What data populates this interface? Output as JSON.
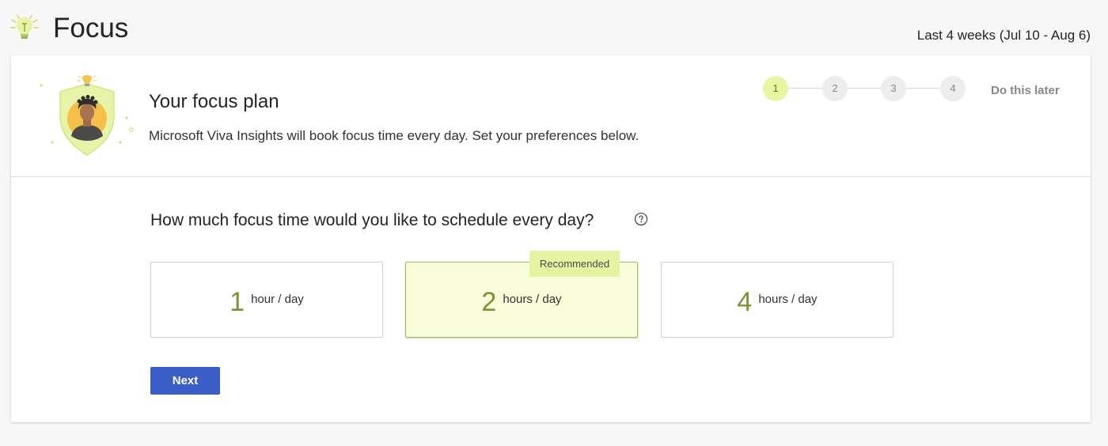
{
  "app": {
    "title": "Focus",
    "icon": "lightbulb-icon",
    "date_range": "Last 4 weeks (Jul 10 - Aug 6)"
  },
  "plan": {
    "title": "Your focus plan",
    "description": "Microsoft Viva Insights will book focus time every day. Set your preferences below.",
    "illustration": "person-shield-illustration"
  },
  "stepper": {
    "steps": [
      "1",
      "2",
      "3",
      "4"
    ],
    "active_step": 1,
    "do_later_label": "Do this later"
  },
  "question": {
    "text": "How much focus time would you like to schedule every day?",
    "help_icon": "question-circle-icon"
  },
  "options": [
    {
      "number": "1",
      "unit": "hour / day",
      "selected": false
    },
    {
      "number": "2",
      "unit": "hours / day",
      "selected": true,
      "badge": "Recommended"
    },
    {
      "number": "4",
      "unit": "hours / day",
      "selected": false
    }
  ],
  "actions": {
    "next_label": "Next"
  },
  "colors": {
    "accent_green": "#7b9431",
    "selected_bg": "#f9fdd9",
    "badge_bg": "#e6f3a3",
    "step_active_bg": "#e8f5a3",
    "primary_button": "#3b5ec6",
    "page_bg": "#f7f7f7"
  }
}
